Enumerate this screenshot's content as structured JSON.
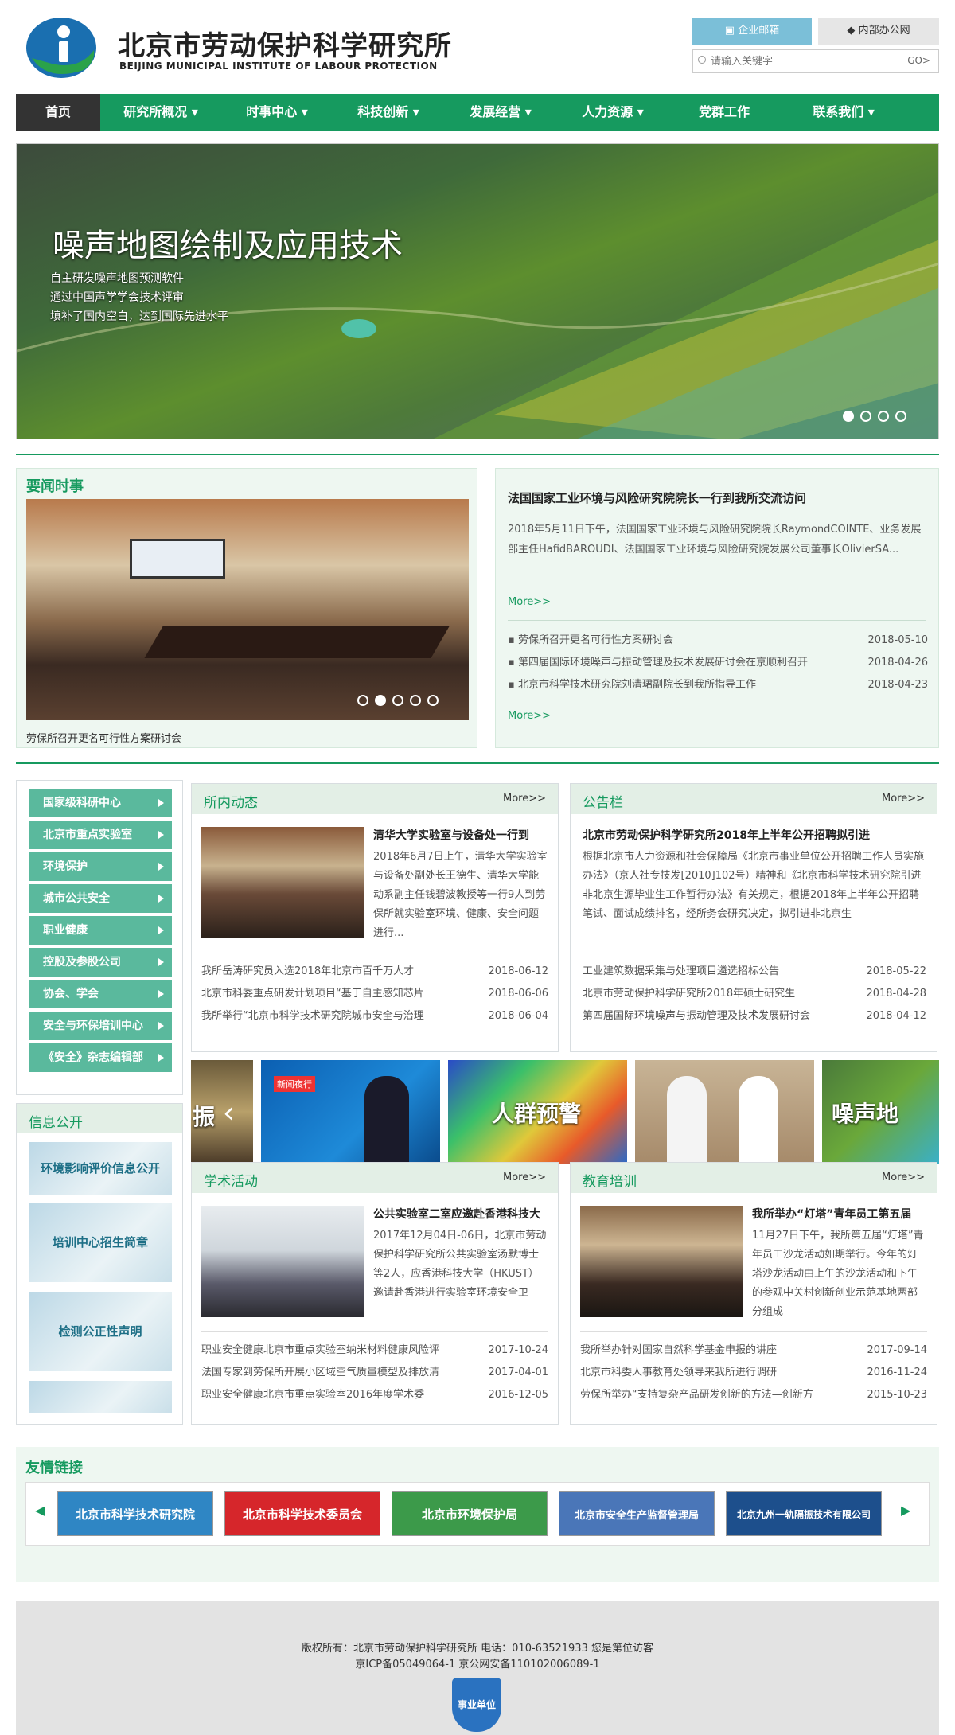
{
  "header": {
    "logo_cn": "北京市劳动保护科学研究所",
    "logo_en": "BEIJING MUNICIPAL INSTITUTE OF LABOUR PROTECTION",
    "btn_mail": "企业邮箱",
    "btn_office": "内部办公网",
    "search_placeholder": "请输入关键字",
    "search_go": "GO>",
    "accent": "#169a5f"
  },
  "nav": [
    "首页",
    "研究所概况",
    "时事中心",
    "科技创新",
    "发展经营",
    "人力资源",
    "党群工作",
    "联系我们"
  ],
  "banner": {
    "title": "噪声地图绘制及应用技术",
    "lines": [
      "自主研发噪声地图预测软件",
      "通过中国声学学会技术评审",
      "填补了国内空白，达到国际先进水平"
    ]
  },
  "news": {
    "title": "要闻时事",
    "photo_caption": "劳保所召开更名可行性方案研讨会",
    "lead_title": "法国国家工业环境与风险研究院院长一行到我所交流访问",
    "lead_text": "2018年5月11日下午，法国国家工业环境与风险研究院院长RaymondCOINTE、业务发展部主任HafidBAROUDI、法国国家工业环境与风险研究院发展公司董事长OlivierSA...",
    "more1": "More>>",
    "more2": "More>>",
    "items": [
      {
        "t": "劳保所召开更名可行性方案研讨会",
        "d": "2018-05-10"
      },
      {
        "t": "第四届国际环境噪声与振动管理及技术发展研讨会在京顺利召开",
        "d": "2018-04-26"
      },
      {
        "t": "北京市科学技术研究院刘清珺副院长到我所指导工作",
        "d": "2018-04-23"
      }
    ]
  },
  "side_menu": [
    "国家级科研中心",
    "北京市重点实验室",
    "环境保护",
    "城市公共安全",
    "职业健康",
    "控股及参股公司",
    "协会、学会",
    "安全与环保培训中心",
    "《安全》杂志编辑部"
  ],
  "info": {
    "title": "信息公开",
    "cards": [
      "环境影响评价信息公开",
      "培训中心招生简章",
      "检测公正性声明"
    ]
  },
  "dynamics": {
    "title": "所内动态",
    "more": "More>>",
    "lead_title": "清华大学实验室与设备处一行到",
    "lead_text": "2018年6月7日上午，清华大学实验室与设备处副处长王德生、清华大学能动系副主任钱碧波教授等一行9人到劳保所就实验室环境、健康、安全问题进行...",
    "items": [
      {
        "t": "我所岳涛研究员入选2018年北京市百千万人才",
        "d": "2018-06-12"
      },
      {
        "t": "北京市科委重点研发计划项目“基于自主感知芯片",
        "d": "2018-06-06"
      },
      {
        "t": "我所举行“北京市科学技术研究院城市安全与治理",
        "d": "2018-06-04"
      }
    ]
  },
  "notice": {
    "title": "公告栏",
    "more": "More>>",
    "lead_title": "北京市劳动保护科学研究所2018年上半年公开招聘拟引进",
    "lead_text": "根据北京市人力资源和社会保障局《北京市事业单位公开招聘工作人员实施办法》（京人社专技发[2010]102号）精神和《北京市科学技术研究院引进非北京生源毕业生工作暂行办法》有关规定，根据2018年上半年公开招聘笔试、面试成绩排名，经所务会研究决定，拟引进非北京生",
    "items": [
      {
        "t": "工业建筑数据采集与处理项目遴选招标公告",
        "d": "2018-05-22"
      },
      {
        "t": "北京市劳动保护科学研究所2018年硕士研究生",
        "d": "2018-04-28"
      },
      {
        "t": "第四届国际环境噪声与振动管理及技术发展研讨会",
        "d": "2018-04-12"
      }
    ]
  },
  "strip": {
    "labels": [
      "振",
      "人群预警",
      "噪声地"
    ],
    "tv_logo": "新闻夜行"
  },
  "academic": {
    "title": "学术活动",
    "more": "More>>",
    "lead_title": "公共实验室二室应邀赴香港科技大",
    "lead_text": "2017年12月04日-06日，北京市劳动保护科学研究所公共实验室汤默博士等2人，应香港科技大学（HKUST）邀请赴香港进行实验室环境安全卫",
    "items": [
      {
        "t": "职业安全健康北京市重点实验室纳米材料健康风险评",
        "d": "2017-10-24"
      },
      {
        "t": "法国专家到劳保所开展小区域空气质量模型及排放清",
        "d": "2017-04-01"
      },
      {
        "t": "职业安全健康北京市重点实验室2016年度学术委",
        "d": "2016-12-05"
      }
    ]
  },
  "training": {
    "title": "教育培训",
    "more": "More>>",
    "lead_title": "我所举办“灯塔”青年员工第五届",
    "lead_text": "11月27日下午，我所第五届“灯塔”青年员工沙龙活动如期举行。今年的灯塔沙龙活动由上午的沙龙活动和下午的参观中关村创新创业示范基地两部分组成",
    "items": [
      {
        "t": "我所举办针对国家自然科学基金申报的讲座",
        "d": "2017-09-14"
      },
      {
        "t": "北京市科委人事教育处领导来我所进行调研",
        "d": "2016-11-24"
      },
      {
        "t": "劳保所举办“支持复杂产品研发创新的方法—创新方",
        "d": "2015-10-23"
      }
    ]
  },
  "links": {
    "title": "友情链接",
    "tiles": [
      {
        "label": "北京市科学技术研究院",
        "color": "#2f86c4"
      },
      {
        "label": "北京市科学技术委员会",
        "color": "#d6262b"
      },
      {
        "label": "北京市环境保护局",
        "color": "#3c9a4a"
      },
      {
        "label": "北京市安全生产监督管理局",
        "color": "#4a76b8"
      },
      {
        "label": "北京九州一轨隔振技术有限公司",
        "color": "#1d4f8c"
      }
    ]
  },
  "footer": {
    "line1": "版权所有：北京市劳动保护科学研究所 电话：010-63521933 您是第位访客",
    "line2": "京ICP备05049064-1 京公网安备110102006089-1",
    "badge": "事业单位"
  }
}
